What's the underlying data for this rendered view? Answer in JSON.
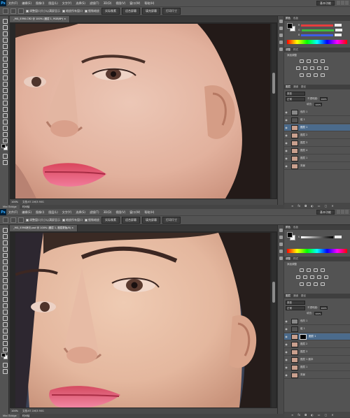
{
  "app": {
    "logo": "Ps",
    "menu": [
      "文件(F)",
      "编辑(E)",
      "图像(I)",
      "图层(L)",
      "文字(Y)",
      "选择(S)",
      "滤镜(T)",
      "3D(D)",
      "视图(V)",
      "窗口(W)",
      "帮助(H)"
    ],
    "workspace": "基本功能",
    "accent": "#31a8ff"
  },
  "options": {
    "resize_windows": "调整窗口大小以满屏显示",
    "zoom_all_windows": "缩放所有窗口",
    "scrubby_zoom": "细微缩放",
    "actual_pixels": "实际像素",
    "fit_screen": "适合屏幕",
    "fill_screen": "填充屏幕",
    "print_size": "打印尺寸"
  },
  "windows": [
    {
      "tab": "_MG_5390.CR2 @ 100% (图层 1, RGB/8*) ×",
      "zoom": "100%",
      "doc_info": "文档:67.1M/3.90G",
      "timeline": "Mini Bridge",
      "timeline2": "时间轴",
      "layer_mode": "正常",
      "opacity_label": "不透明度:",
      "opacity": "100%",
      "fill_label": "填充:",
      "fill": "100%",
      "layers": [
        {
          "name": "色阶 1",
          "type": "adjust",
          "visible": true
        },
        {
          "name": "组 1",
          "type": "group",
          "visible": true
        },
        {
          "name": "图层 1",
          "type": "image",
          "visible": true,
          "selected": true
        },
        {
          "name": "图层 2",
          "type": "image",
          "visible": true
        },
        {
          "name": "图层 3",
          "type": "image",
          "visible": true
        },
        {
          "name": "图层 4",
          "type": "image",
          "visible": true
        },
        {
          "name": "图层 1",
          "type": "image",
          "visible": true
        },
        {
          "name": "背景",
          "type": "image",
          "visible": true
        }
      ]
    },
    {
      "tab": "_MG_5390拷贝.psd @ 100% (图层 1, 图层蒙版/8) ×",
      "zoom": "100%",
      "doc_info": "文档:67.1M/3.90G",
      "timeline": "Mini Bridge",
      "timeline2": "时间轴",
      "layer_mode": "正常",
      "opacity_label": "不透明度:",
      "opacity": "100%",
      "fill_label": "填充:",
      "fill": "100%",
      "layers": [
        {
          "name": "色阶 1",
          "type": "adjust",
          "visible": true
        },
        {
          "name": "组 1",
          "type": "group",
          "visible": true
        },
        {
          "name": "图层 1",
          "type": "image",
          "visible": true,
          "selected": true,
          "mask": true
        },
        {
          "name": "图层 2",
          "type": "image",
          "visible": true
        },
        {
          "name": "图层 3",
          "type": "image",
          "visible": true
        },
        {
          "name": "图层 1 副本",
          "type": "image",
          "visible": true
        },
        {
          "name": "图层 1",
          "type": "image",
          "visible": true
        },
        {
          "name": "背景",
          "type": "image",
          "visible": true
        }
      ]
    }
  ],
  "panels": {
    "color_tab": "颜色",
    "swatches_tab": "色板",
    "adjustments_tab": "调整",
    "styles_tab": "样式",
    "add_adjustment": "添加调整",
    "layers_tab": "图层",
    "channels_tab": "通道",
    "paths_tab": "路径",
    "filter_kind": "类型"
  },
  "colors": {
    "fg": "#000000",
    "bg": "#ffffff",
    "slider_r": "#e63d3d",
    "slider_g": "#3dba3d",
    "slider_b": "#3d5de6",
    "selected_layer": "#4b6b8c"
  }
}
